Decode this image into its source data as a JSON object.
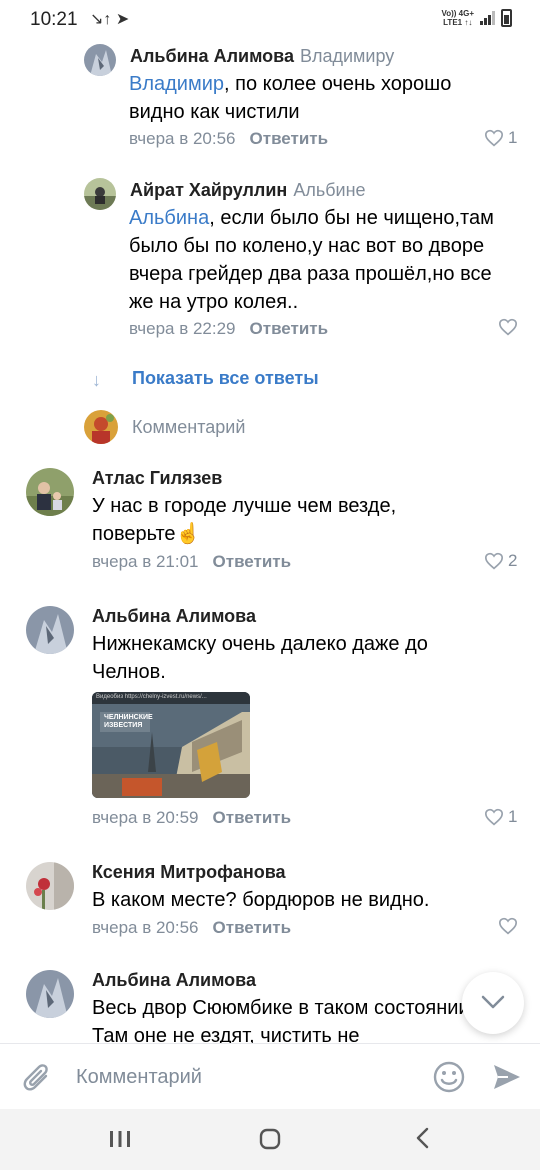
{
  "status_bar": {
    "time": "10:21",
    "left_icons": "↘↑ ➤",
    "network_top": "Vo)) 4G+",
    "network_bottom": "LTE1 ↑↓"
  },
  "thread": {
    "replies": [
      {
        "author": "Альбина Алимова",
        "reply_to": "Владимиру",
        "mention": "Владимир",
        "text": ", по колее очень хорошо видно как чистили",
        "time": "вчера в 20:56",
        "reply_label": "Ответить",
        "likes": "1"
      },
      {
        "author": "Айрат Хайруллин",
        "reply_to": "Альбине",
        "mention": "Альбина",
        "text": ", если было бы не чищено,там было бы по колено,у нас вот во дворе вчера грейдер два раза прошёл,но все же на утро колея..",
        "time": "вчера в 22:29",
        "reply_label": "Ответить",
        "likes": ""
      }
    ],
    "show_all_label": "Показать все ответы",
    "write_comment_placeholder": "Комментарий"
  },
  "comments": [
    {
      "author": "Атлас Гилязев",
      "text": "У нас в городе лучше чем везде, поверьте",
      "emoji": "☝️",
      "time": "вчера в 21:01",
      "reply_label": "Ответить",
      "likes": "2"
    },
    {
      "author": "Альбина Алимова",
      "text": "Нижнекамску очень далеко даже до Челнов.",
      "attachment": {
        "logo_text": "ЧЕЛНИНСКИЕ ИЗВЕСТИЯ",
        "top_text": "Видеобиз https://chelny-izvest.ru/news/..."
      },
      "time": "вчера в 20:59",
      "reply_label": "Ответить",
      "likes": "1"
    },
    {
      "author": "Ксения Митрофанова",
      "text": "В каком месте? бордюров не видно.",
      "time": "вчера в 20:56",
      "reply_label": "Ответить",
      "likes": ""
    },
    {
      "author": "Альбина Алимова",
      "text": "Весь двор Сююмбике в таком состоянии. Там оне не ездят, чистить не"
    }
  ],
  "compose": {
    "placeholder": "Комментарий"
  },
  "colors": {
    "accent": "#3a7bc8",
    "secondary_text": "#818c99",
    "icon_gray": "#99a2ad"
  }
}
